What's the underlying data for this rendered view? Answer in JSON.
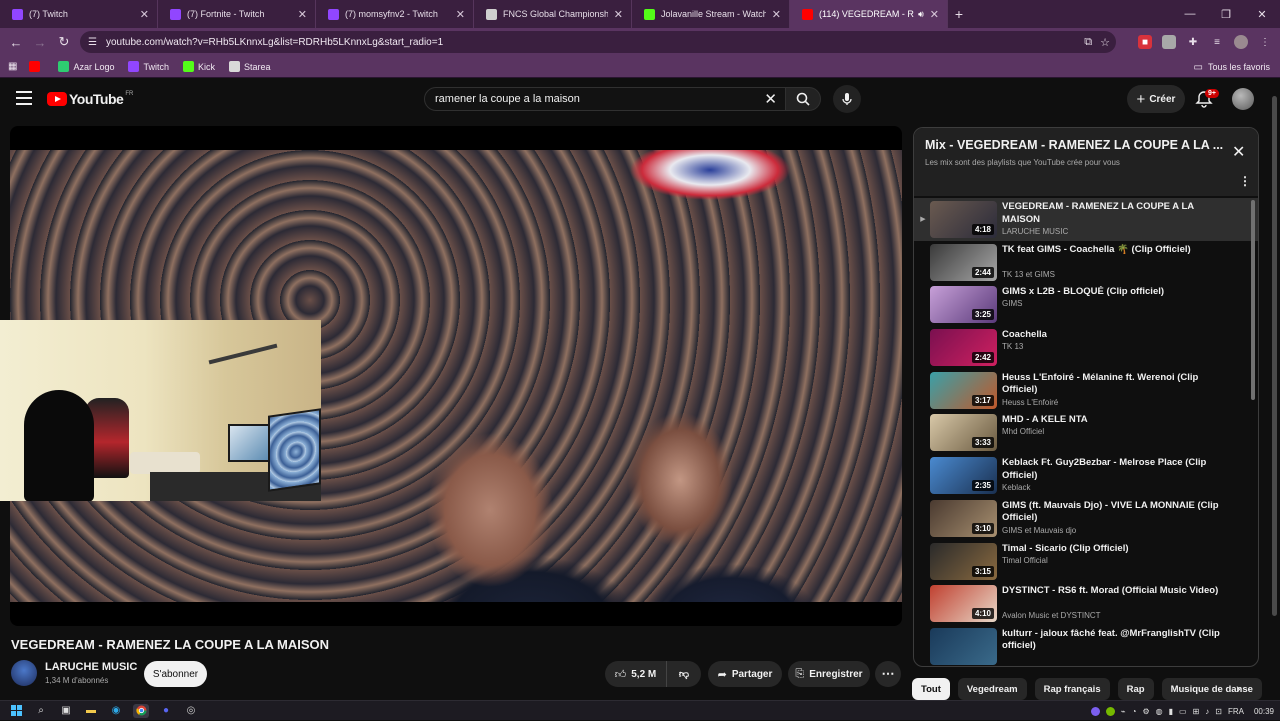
{
  "browser": {
    "tabs": [
      {
        "title": "(7) Twitch",
        "favicon_color": "#9146ff",
        "active": false
      },
      {
        "title": "(7) Fortnite - Twitch",
        "favicon_color": "#9146ff",
        "active": false
      },
      {
        "title": "(7) momsyfnv2 - Twitch",
        "favicon_color": "#9146ff",
        "active": false
      },
      {
        "title": "FNCS Global Championship La...",
        "favicon_color": "#cfcfcf",
        "active": false
      },
      {
        "title": "Jolavanille Stream - Watch Live",
        "favicon_color": "#53fc18",
        "active": false
      },
      {
        "title": "(114) VEGEDREAM - RAMEN",
        "favicon_color": "#ff0000",
        "active": true
      }
    ],
    "new_tab_icon": "plus-icon",
    "url": "youtube.com/watch?v=RHb5LKnnxLg&list=RDRHb5LKnnxLg&start_radio=1",
    "bookmarks": [
      {
        "label": "",
        "icon_color": "#ff0000"
      },
      {
        "label": "Azar Logo",
        "icon_color": "#2ecc71"
      },
      {
        "label": "Twitch",
        "icon_color": "#9146ff"
      },
      {
        "label": "Kick",
        "icon_color": "#53fc18"
      },
      {
        "label": "Starea",
        "icon_color": "#d9d9d9"
      }
    ],
    "all_bookmarks": "Tous les favoris"
  },
  "youtube": {
    "logo_text": "YouTube",
    "region": "FR",
    "search_query": "ramener la coupe a la maison",
    "create_label": "Créer",
    "notification_count": "9+"
  },
  "video": {
    "title": "VEGEDREAM - RAMENEZ LA COUPE A LA MAISON",
    "channel": "LARUCHE MUSIC",
    "subscribers": "1,34 M d'abonnés",
    "subscribe_label": "S'abonner",
    "likes": "5,2 M",
    "share_label": "Partager",
    "save_label": "Enregistrer"
  },
  "mix": {
    "title": "Mix - VEGEDREAM - RAMENEZ LA COUPE A LA ...",
    "subtitle": "Les mix sont des playlists que YouTube crée pour vous",
    "items": [
      {
        "title": "VEGEDREAM - RAMENEZ LA COUPE A LA MAISON",
        "channel": "LARUCHE MUSIC",
        "duration": "4:18",
        "active": true,
        "thumb": "linear-gradient(135deg,#6a5a50,#2b2b3a)"
      },
      {
        "title": "TK feat GIMS - Coachella 🌴 (Clip Officiel)",
        "channel": "TK 13 et GIMS",
        "duration": "2:44",
        "active": false,
        "thumb": "linear-gradient(135deg,#3a3a3a,#a8a8a8)"
      },
      {
        "title": "GIMS x L2B - BLOQUÉ (Clip officiel)",
        "channel": "GIMS",
        "duration": "3:25",
        "active": false,
        "thumb": "linear-gradient(135deg,#c7a0d8,#5a3a7a)"
      },
      {
        "title": "Coachella",
        "channel": "TK 13",
        "duration": "2:42",
        "active": false,
        "thumb": "linear-gradient(135deg,#7a1050,#d02060)"
      },
      {
        "title": "Heuss L'Enfoiré - Mélanine ft. Werenoi (Clip Officiel)",
        "channel": "Heuss L'Enfoiré",
        "duration": "3:17",
        "active": false,
        "thumb": "linear-gradient(135deg,#3aa0a8,#c0582a)"
      },
      {
        "title": "MHD - A KELE NTA",
        "channel": "Mhd Officiel",
        "duration": "3:33",
        "active": false,
        "thumb": "linear-gradient(135deg,#d8c8a8,#6a5a40)"
      },
      {
        "title": "Keblack Ft. Guy2Bezbar - Melrose Place (Clip Officiel)",
        "channel": "Keblack",
        "duration": "2:35",
        "active": false,
        "thumb": "linear-gradient(135deg,#4a8ad0,#1a3050)"
      },
      {
        "title": "GIMS (ft. Mauvais Djo) - VIVE LA MONNAIE (Clip Officiel)",
        "channel": "GIMS et Mauvais djo",
        "duration": "3:10",
        "active": false,
        "thumb": "linear-gradient(135deg,#4a3a30,#a89070)"
      },
      {
        "title": "Timal - Sicario (Clip Officiel)",
        "channel": "Timal Official",
        "duration": "3:15",
        "active": false,
        "thumb": "linear-gradient(135deg,#2a2a2a,#8a6a40)"
      },
      {
        "title": "DYSTINCT - RS6 ft. Morad (Official Music Video)",
        "channel": "Avalon Music et DYSTINCT",
        "duration": "4:10",
        "active": false,
        "thumb": "linear-gradient(135deg,#c04030,#e8d8c8)"
      },
      {
        "title": "kulturr - jaloux fâché feat. @MrFranglishTV (Clip officiel)",
        "channel": "",
        "duration": "",
        "active": false,
        "thumb": "linear-gradient(135deg,#1a3a5a,#3a6a8a)"
      }
    ]
  },
  "chips": [
    {
      "label": "Tout",
      "active": true
    },
    {
      "label": "Vegedream",
      "active": false
    },
    {
      "label": "Rap français",
      "active": false
    },
    {
      "label": "Rap",
      "active": false
    },
    {
      "label": "Musique de danse",
      "active": false
    }
  ],
  "taskbar": {
    "time": "00:39",
    "lang": "FRA"
  }
}
